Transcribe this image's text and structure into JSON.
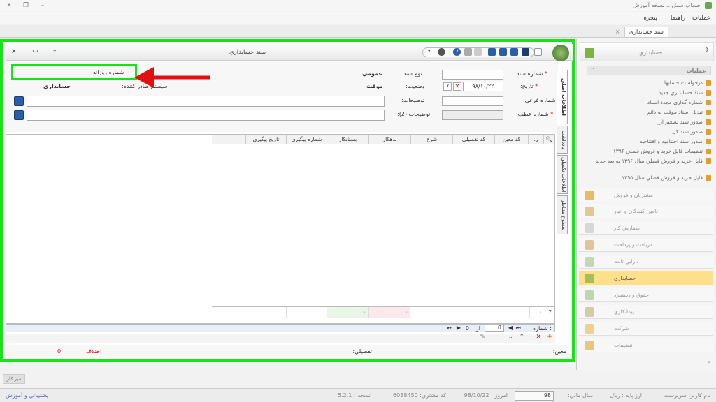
{
  "app": {
    "title": "حساب سش.1 نسخه آموزش"
  },
  "menu": [
    "عملیات",
    "راهنما",
    "پنجره"
  ],
  "doc_tab": {
    "label": "سند حسابداری",
    "close": "×"
  },
  "window": {
    "title": "سند حسابداري",
    "close": "×",
    "restore": "▭",
    "minimize": "–",
    "help": "?"
  },
  "form": {
    "doc_number_label": "شماره سند:",
    "doc_type_label": "نوع سند:",
    "doc_type_value": "عمومي",
    "daily_number_label": "شماره روزانه:",
    "date_label": "تاريخ:",
    "date_value": "۹۸/۱۰/۲۲",
    "status_label": "وضعيت:",
    "status_value": "موقت",
    "issuer_label": "سيستم صادر كننده:",
    "issuer_value": "حسابداري",
    "sub_number_label": "شماره فرعي:",
    "desc_label": "توضيحات:",
    "desc2_label": "توضيحات (2):",
    "ref_number_label": "شماره عطف:",
    "required_mark": "*"
  },
  "side_tabs": [
    "اطلاعات اصلي",
    "يادداشت",
    "اطلاعات تكميلي",
    "سطوح متناظر"
  ],
  "grid": {
    "columns": [
      "ر.",
      "كد معين",
      "كد تفصيلي",
      "شرح",
      "بدهكار",
      "بستانكار",
      "شماره پيگيري",
      "تاريخ پيگيري"
    ],
    "footer_debit": "۰",
    "footer_credit": "۰",
    "footer_first": "۰",
    "sum_icon": "Σ",
    "search_icon": "🔍"
  },
  "pager": {
    "label": ": شماره",
    "of": "از",
    "total": "0",
    "current": "0"
  },
  "bottom": {
    "moein_label": "معين:",
    "tafsili_label": "تفصيلي:",
    "diff_label": "اختلاف:",
    "diff_value": "0"
  },
  "right_panel": {
    "header": "حسابداري",
    "ops_header": "عمليات",
    "ops": [
      "درخواست حسابها",
      "سند حسابداري جديد",
      "شماره گذاري مجدد اسناد",
      "تبديل اسناد موقت به دائم",
      "صدور سند تسعير ارز",
      "صدور سند كل",
      "صدور سند اختتاميه و افتتاحيه",
      "تنظيمات فايل خريد و فروش فصلي ۱۳۹۶",
      "فايل خريد و فروش فصلي سال ۱۳۹۶ به بعد جديد",
      "فايل خريد و فروش فصلي سال ۱۳۹۵ ..."
    ],
    "modules": [
      "مشتريان و فروش",
      "تامين كنندگان و انبار",
      "سفارش كار",
      "دريافت و پرداخت",
      "دارايي ثابت",
      "حسابداري",
      "حقوق و دستمزد",
      "پيمانكاري",
      "شركت",
      "تنظيمات"
    ],
    "active_module": "حسابداري"
  },
  "status": {
    "user": "نام كاربر: سرپرست",
    "currency": "ارز پايه : ريال",
    "year_label": "سال مالي:",
    "year_value": "98",
    "today": "امروز : 98/10/22",
    "customer_code": "كد مشتري: 6038450",
    "version": "نسخه : 5.2.1",
    "support": "پشتيباني و آموزش",
    "desktop": "ميز كار"
  }
}
